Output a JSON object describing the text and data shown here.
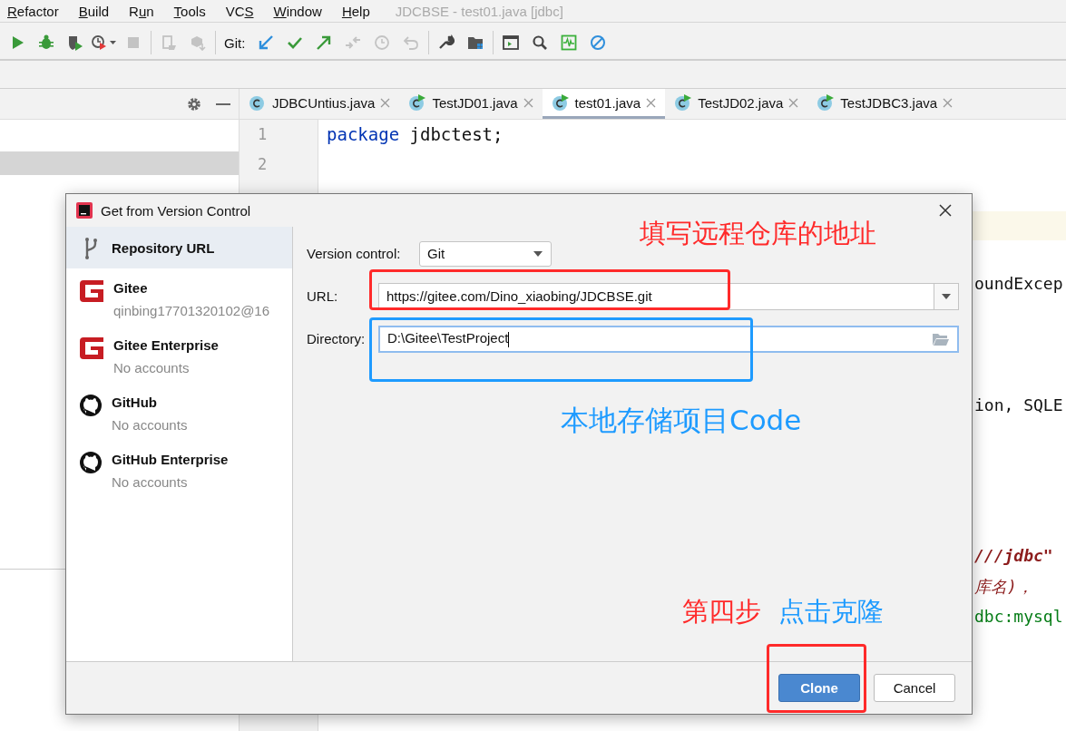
{
  "menu": [
    {
      "key": "R",
      "post": "efactor"
    },
    {
      "key": "B",
      "post": "uild"
    },
    {
      "pre": "R",
      "key": "u",
      "post": "n"
    },
    {
      "key": "T",
      "post": "ools"
    },
    {
      "pre": "VC",
      "key": "S"
    },
    {
      "key": "W",
      "post": "indow"
    },
    {
      "key": "H",
      "post": "elp"
    }
  ],
  "window": {
    "title": "JDCBSE - test01.java [jdbc]"
  },
  "toolbar": {
    "items": [
      {
        "kind": "run",
        "disabled": false
      },
      {
        "kind": "debug",
        "disabled": false
      },
      {
        "kind": "coverage",
        "disabled": false
      },
      {
        "kind": "profile",
        "disabled": false
      },
      {
        "kind": "stop",
        "disabled": true
      },
      {
        "kind": "separator"
      },
      {
        "kind": "device",
        "disabled": true
      },
      {
        "kind": "package",
        "disabled": true
      },
      {
        "kind": "separator"
      },
      {
        "kind": "git-label",
        "text": "Git:"
      },
      {
        "kind": "update",
        "disabled": false
      },
      {
        "kind": "commit",
        "disabled": false
      },
      {
        "kind": "push",
        "disabled": false
      },
      {
        "kind": "merge",
        "disabled": true
      },
      {
        "kind": "history",
        "disabled": true
      },
      {
        "kind": "revert",
        "disabled": true
      },
      {
        "kind": "separator"
      },
      {
        "kind": "wrench",
        "disabled": false
      },
      {
        "kind": "structure",
        "disabled": false
      },
      {
        "kind": "separator"
      },
      {
        "kind": "terminal",
        "disabled": false
      },
      {
        "kind": "search",
        "disabled": false
      },
      {
        "kind": "monitor",
        "disabled": false
      },
      {
        "kind": "nosign",
        "disabled": false
      }
    ]
  },
  "tabs": [
    {
      "label": "JDBCUntius.java",
      "runnable": false,
      "selected": false
    },
    {
      "label": "TestJD01.java",
      "runnable": true,
      "selected": false
    },
    {
      "label": "test01.java",
      "runnable": true,
      "selected": true
    },
    {
      "label": "TestJD02.java",
      "runnable": true,
      "selected": false
    },
    {
      "label": "TestJDBC3.java",
      "runnable": true,
      "selected": false
    }
  ],
  "code_lines": [
    {
      "number": "1",
      "parts": [
        {
          "kind": "keyword",
          "text": "package"
        },
        {
          "kind": "plain",
          "text": " jdbctest;"
        }
      ]
    },
    {
      "number": "2"
    }
  ],
  "code_fragments": [
    {
      "kind": "plain",
      "text": "oundExcep"
    },
    {
      "kind": "plain",
      "text": "ion, SQLE"
    },
    {
      "kind": "string",
      "text": "///jdbc\""
    },
    {
      "kind": "comment",
      "text": "库名)，"
    },
    {
      "kind": "green",
      "text": "dbc:mysql"
    }
  ],
  "dialog": {
    "title": "Get from Version Control",
    "sources": [
      {
        "kind": "repo",
        "label": "Repository URL",
        "selected": true
      },
      {
        "kind": "gitee",
        "label": "Gitee",
        "detail": "qinbing17701320102@16",
        "selected": false
      },
      {
        "kind": "gitee",
        "label": "Gitee Enterprise",
        "detail": "No accounts",
        "selected": false
      },
      {
        "kind": "github",
        "label": "GitHub",
        "detail": "No accounts",
        "selected": false
      },
      {
        "kind": "github",
        "label": "GitHub Enterprise",
        "detail": "No accounts",
        "selected": false
      }
    ],
    "version_control": {
      "label": "Version control:",
      "value": "Git"
    },
    "url": {
      "label": "URL:",
      "value": "https://gitee.com/Dino_xiaobing/JDCBSE.git"
    },
    "directory": {
      "label": "Directory:",
      "value": "D:\\Gitee\\TestProject",
      "focused": true
    },
    "buttons": [
      {
        "label": "Clone",
        "primary": true
      },
      {
        "label": "Cancel",
        "primary": false
      }
    ]
  },
  "annotations": [
    {
      "kind": "text",
      "text": "填写远程仓库的地址",
      "color": "#ff2a2a"
    },
    {
      "kind": "box",
      "color": "#ff2a2a"
    },
    {
      "kind": "box",
      "color": "#1e9bff"
    },
    {
      "kind": "text",
      "text": "本地存储项目Code",
      "color": "#1e9bff"
    },
    {
      "kind": "text",
      "text": "第四步",
      "color": "#ff2a2a"
    },
    {
      "kind": "text",
      "text": "点击克隆",
      "color": "#1e9bff"
    },
    {
      "kind": "box",
      "color": "#ff2a2a"
    }
  ]
}
